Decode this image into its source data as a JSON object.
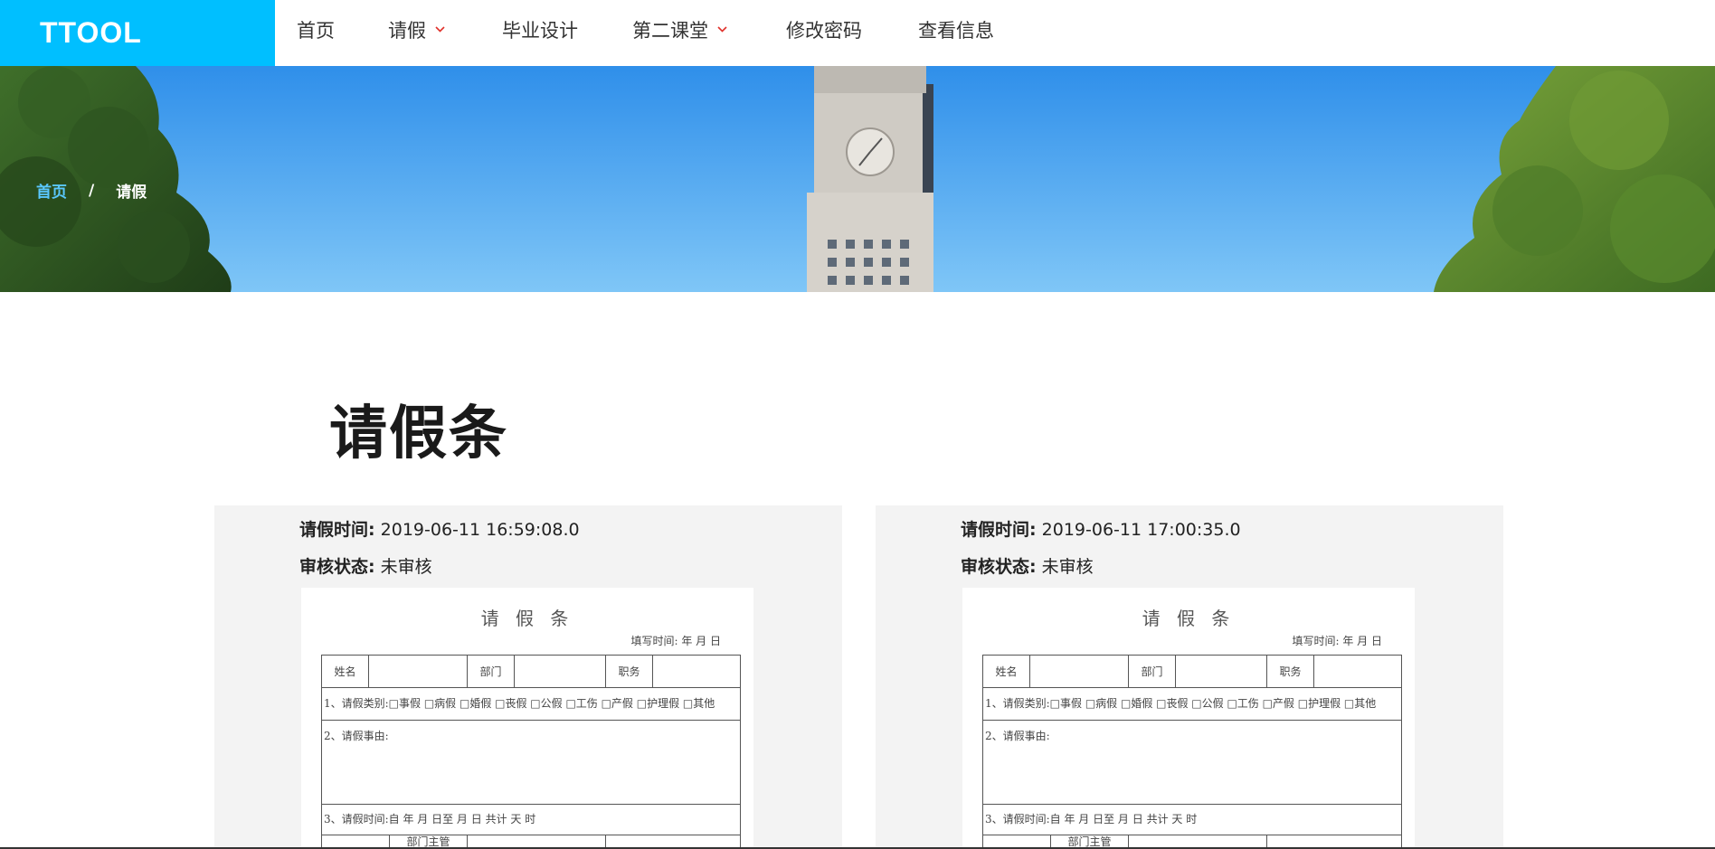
{
  "header": {
    "logo": "TTOOL",
    "nav": [
      {
        "label": "首页",
        "dropdown": false
      },
      {
        "label": "请假",
        "dropdown": true
      },
      {
        "label": "毕业设计",
        "dropdown": false
      },
      {
        "label": "第二课堂",
        "dropdown": true
      },
      {
        "label": "修改密码",
        "dropdown": false
      },
      {
        "label": "查看信息",
        "dropdown": false
      }
    ]
  },
  "breadcrumb": {
    "home": "首页",
    "separator": "/",
    "current": "请假"
  },
  "page_title": "请假条",
  "records": [
    {
      "time_label": "请假时间:",
      "time_value": "2019-06-11 16:59:08.0",
      "status_label": "审核状态:",
      "status_value": "未审核"
    },
    {
      "time_label": "请假时间:",
      "time_value": "2019-06-11 17:00:35.0",
      "status_label": "审核状态:",
      "status_value": "未审核"
    }
  ],
  "form_image": {
    "title": "请 假 条",
    "fill_date": "填写时间:    年   月   日",
    "name": "姓名",
    "dept": "部门",
    "position": "职务",
    "leave_type": "1、请假类别:□事假 □病假 □婚假 □丧假 □公假 □工伤 □产假 □护理假 □其他",
    "reason": "2、请假事由:",
    "period": "3、请假时间:自      年     月     日至     月     日       共计      天      时",
    "dept_head": "部门主管"
  },
  "colors": {
    "brand": "#00bfff",
    "caret": "#e0302a",
    "card_bg": "#f3f3f3",
    "breadcrumb_home": "#5ac8ff"
  }
}
